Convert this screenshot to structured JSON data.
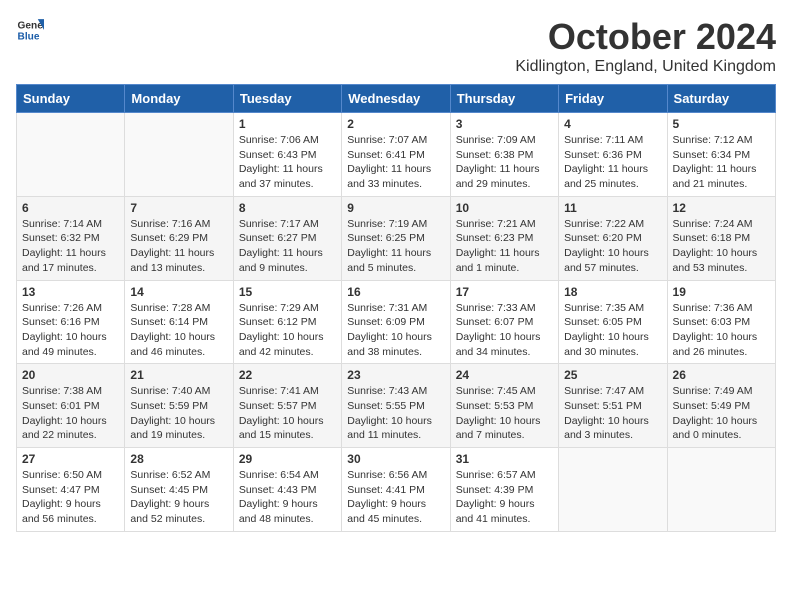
{
  "logo": {
    "general": "General",
    "blue": "Blue"
  },
  "title": "October 2024",
  "location": "Kidlington, England, United Kingdom",
  "weekdays": [
    "Sunday",
    "Monday",
    "Tuesday",
    "Wednesday",
    "Thursday",
    "Friday",
    "Saturday"
  ],
  "weeks": [
    [
      {
        "day": "",
        "info": ""
      },
      {
        "day": "",
        "info": ""
      },
      {
        "day": "1",
        "info": "Sunrise: 7:06 AM\nSunset: 6:43 PM\nDaylight: 11 hours and 37 minutes."
      },
      {
        "day": "2",
        "info": "Sunrise: 7:07 AM\nSunset: 6:41 PM\nDaylight: 11 hours and 33 minutes."
      },
      {
        "day": "3",
        "info": "Sunrise: 7:09 AM\nSunset: 6:38 PM\nDaylight: 11 hours and 29 minutes."
      },
      {
        "day": "4",
        "info": "Sunrise: 7:11 AM\nSunset: 6:36 PM\nDaylight: 11 hours and 25 minutes."
      },
      {
        "day": "5",
        "info": "Sunrise: 7:12 AM\nSunset: 6:34 PM\nDaylight: 11 hours and 21 minutes."
      }
    ],
    [
      {
        "day": "6",
        "info": "Sunrise: 7:14 AM\nSunset: 6:32 PM\nDaylight: 11 hours and 17 minutes."
      },
      {
        "day": "7",
        "info": "Sunrise: 7:16 AM\nSunset: 6:29 PM\nDaylight: 11 hours and 13 minutes."
      },
      {
        "day": "8",
        "info": "Sunrise: 7:17 AM\nSunset: 6:27 PM\nDaylight: 11 hours and 9 minutes."
      },
      {
        "day": "9",
        "info": "Sunrise: 7:19 AM\nSunset: 6:25 PM\nDaylight: 11 hours and 5 minutes."
      },
      {
        "day": "10",
        "info": "Sunrise: 7:21 AM\nSunset: 6:23 PM\nDaylight: 11 hours and 1 minute."
      },
      {
        "day": "11",
        "info": "Sunrise: 7:22 AM\nSunset: 6:20 PM\nDaylight: 10 hours and 57 minutes."
      },
      {
        "day": "12",
        "info": "Sunrise: 7:24 AM\nSunset: 6:18 PM\nDaylight: 10 hours and 53 minutes."
      }
    ],
    [
      {
        "day": "13",
        "info": "Sunrise: 7:26 AM\nSunset: 6:16 PM\nDaylight: 10 hours and 49 minutes."
      },
      {
        "day": "14",
        "info": "Sunrise: 7:28 AM\nSunset: 6:14 PM\nDaylight: 10 hours and 46 minutes."
      },
      {
        "day": "15",
        "info": "Sunrise: 7:29 AM\nSunset: 6:12 PM\nDaylight: 10 hours and 42 minutes."
      },
      {
        "day": "16",
        "info": "Sunrise: 7:31 AM\nSunset: 6:09 PM\nDaylight: 10 hours and 38 minutes."
      },
      {
        "day": "17",
        "info": "Sunrise: 7:33 AM\nSunset: 6:07 PM\nDaylight: 10 hours and 34 minutes."
      },
      {
        "day": "18",
        "info": "Sunrise: 7:35 AM\nSunset: 6:05 PM\nDaylight: 10 hours and 30 minutes."
      },
      {
        "day": "19",
        "info": "Sunrise: 7:36 AM\nSunset: 6:03 PM\nDaylight: 10 hours and 26 minutes."
      }
    ],
    [
      {
        "day": "20",
        "info": "Sunrise: 7:38 AM\nSunset: 6:01 PM\nDaylight: 10 hours and 22 minutes."
      },
      {
        "day": "21",
        "info": "Sunrise: 7:40 AM\nSunset: 5:59 PM\nDaylight: 10 hours and 19 minutes."
      },
      {
        "day": "22",
        "info": "Sunrise: 7:41 AM\nSunset: 5:57 PM\nDaylight: 10 hours and 15 minutes."
      },
      {
        "day": "23",
        "info": "Sunrise: 7:43 AM\nSunset: 5:55 PM\nDaylight: 10 hours and 11 minutes."
      },
      {
        "day": "24",
        "info": "Sunrise: 7:45 AM\nSunset: 5:53 PM\nDaylight: 10 hours and 7 minutes."
      },
      {
        "day": "25",
        "info": "Sunrise: 7:47 AM\nSunset: 5:51 PM\nDaylight: 10 hours and 3 minutes."
      },
      {
        "day": "26",
        "info": "Sunrise: 7:49 AM\nSunset: 5:49 PM\nDaylight: 10 hours and 0 minutes."
      }
    ],
    [
      {
        "day": "27",
        "info": "Sunrise: 6:50 AM\nSunset: 4:47 PM\nDaylight: 9 hours and 56 minutes."
      },
      {
        "day": "28",
        "info": "Sunrise: 6:52 AM\nSunset: 4:45 PM\nDaylight: 9 hours and 52 minutes."
      },
      {
        "day": "29",
        "info": "Sunrise: 6:54 AM\nSunset: 4:43 PM\nDaylight: 9 hours and 48 minutes."
      },
      {
        "day": "30",
        "info": "Sunrise: 6:56 AM\nSunset: 4:41 PM\nDaylight: 9 hours and 45 minutes."
      },
      {
        "day": "31",
        "info": "Sunrise: 6:57 AM\nSunset: 4:39 PM\nDaylight: 9 hours and 41 minutes."
      },
      {
        "day": "",
        "info": ""
      },
      {
        "day": "",
        "info": ""
      }
    ]
  ]
}
